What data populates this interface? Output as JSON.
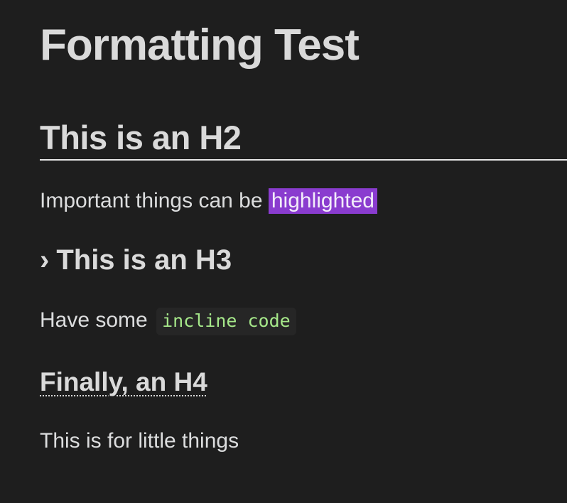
{
  "document": {
    "h1": "Formatting Test",
    "h2": "This is an H2",
    "paragraph1": {
      "prefix": "Important things can be ",
      "highlight": "highlighted"
    },
    "h3": {
      "marker": "›",
      "text": "This is an H3"
    },
    "paragraph2": {
      "prefix": "Have some ",
      "code": "incline code"
    },
    "h4": "Finally, an H4",
    "paragraph3": "This is for little things"
  },
  "colors": {
    "background": "#1e1e1e",
    "text": "#dcddde",
    "highlight_bg": "#8a3ccf",
    "code_text": "#a6e88a",
    "code_bg": "#262626"
  }
}
